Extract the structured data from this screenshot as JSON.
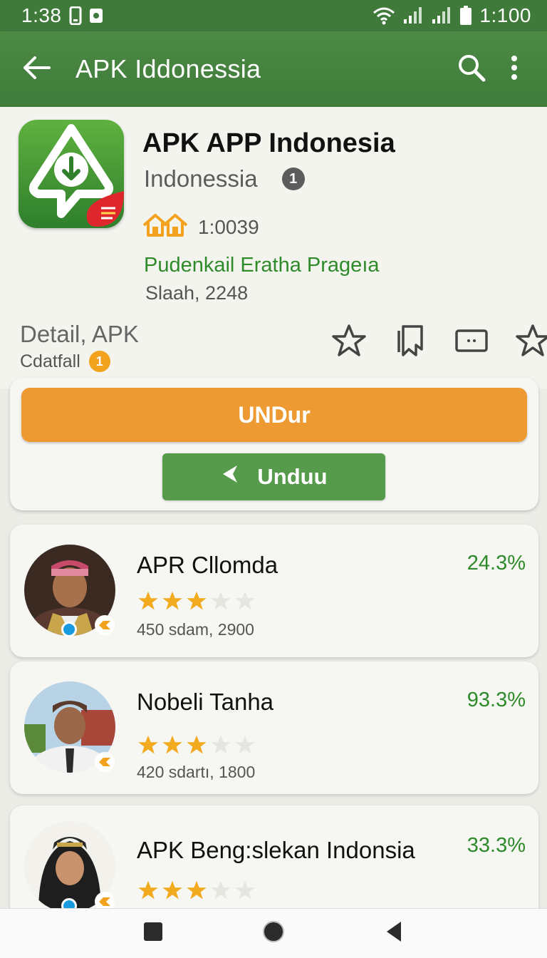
{
  "status_bar": {
    "time": "1:38",
    "battery_text": "1:100",
    "icons": [
      "phone-icon",
      "notification-icon",
      "wifi-icon",
      "signal-icon",
      "signal-icon",
      "battery-icon"
    ]
  },
  "app_bar": {
    "title": "APK Iddonessia",
    "icons": [
      "back-arrow-icon",
      "search-icon",
      "more-vert-icon"
    ]
  },
  "app_header": {
    "name": "APK APP Indonesia",
    "subtitle": "Indonessia",
    "info_badge": "1",
    "rating_count": "1:0039",
    "developer": "Pudenkail Eratha Prageıa",
    "size": "Slaah, 2248",
    "detail_title": "Detail, APK",
    "detail_sub": "Cdatfall",
    "detail_badge": "1",
    "action_icons": [
      "star-outline-icon",
      "bookmark-icon",
      "message-icon",
      "star-outline-icon"
    ]
  },
  "install": {
    "primary_label": "UNDur",
    "secondary_label": "Unduu"
  },
  "list": {
    "items": [
      {
        "title": "APR Cllomda",
        "percent": "24.3%",
        "rating": 3,
        "meta": "450 sdam, 2900"
      },
      {
        "title": "Nobeli Tanha",
        "percent": "93.3%",
        "rating": 3,
        "meta": "420 sdartı, 1800"
      },
      {
        "title": "APK Beng:slekan Indonsia",
        "percent": "33.3%",
        "rating": 3,
        "meta": ""
      }
    ]
  },
  "nav_bar": {
    "icons": [
      "recents-square-icon",
      "home-circle-icon",
      "back-triangle-icon"
    ]
  },
  "colors": {
    "primary_green": "#3f7a3a",
    "accent_orange": "#ec9a31",
    "button_green": "#569a4c",
    "percent_green": "#2e8a2a",
    "star_gold": "#f2aa1f"
  }
}
